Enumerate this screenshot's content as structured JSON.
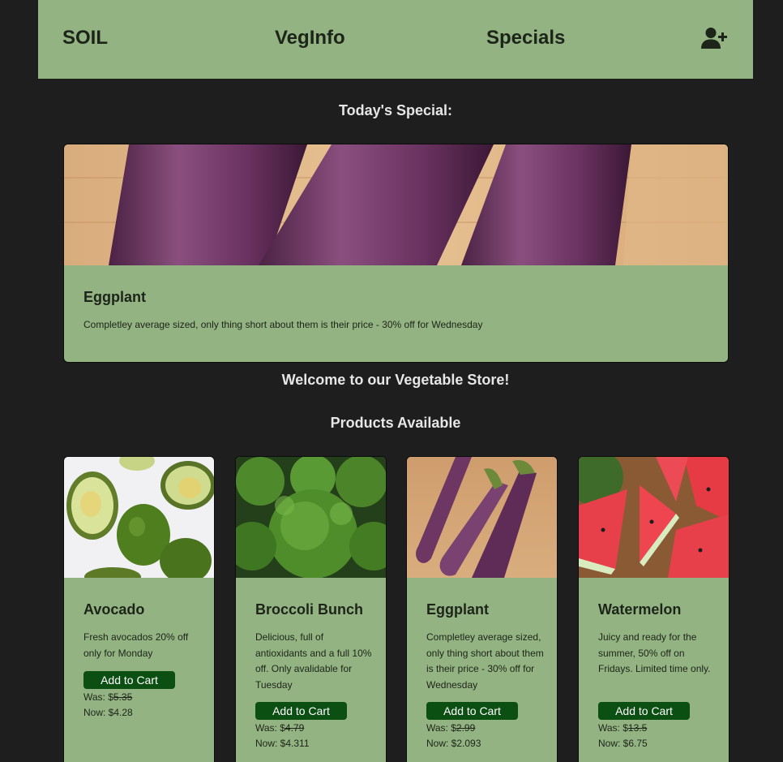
{
  "nav": {
    "brand": "SOIL",
    "veginfo": "VegInfo",
    "specials": "Specials",
    "user_icon": "user-plus-icon"
  },
  "todays_special_heading": "Today's Special:",
  "special": {
    "title": "Eggplant",
    "description": "Completley average sized, only thing short about them is their price - 30% off for Wednesday",
    "image": "eggplant-image"
  },
  "welcome_heading": "Welcome to our Vegetable Store!",
  "products_heading": "Products Available",
  "products": [
    {
      "name": "Avocado",
      "description": "Fresh avocados 20% off only for Monday",
      "button": "Add to Cart",
      "was_label": "Was: $",
      "was_price": "5.35",
      "now_label": "Now: $",
      "now_price": "4.28",
      "image": "avocado-image"
    },
    {
      "name": "Broccoli Bunch",
      "description": "Delicious, full of antioxidants and a full 10% off. Only avalidable for Tuesday",
      "button": "Add to Cart",
      "was_label": "Was: $",
      "was_price": "4.79",
      "now_label": "Now: $",
      "now_price": "4.311",
      "image": "broccoli-image"
    },
    {
      "name": "Eggplant",
      "description": "Completley average sized, only thing short about them is their price - 30% off for Wednesday",
      "button": "Add to Cart",
      "was_label": "Was: $",
      "was_price": "2.99",
      "now_label": "Now: $",
      "now_price": "2.093",
      "image": "eggplant-image"
    },
    {
      "name": "Watermelon",
      "description": "Juicy and ready for the summer, 50% off on Fridays. Limited time only.",
      "button": "Add to Cart",
      "was_label": "Was: $",
      "was_price": "13.5",
      "now_label": "Now: $",
      "now_price": "6.75",
      "image": "watermelon-image"
    }
  ],
  "colors": {
    "background": "#1e1e1f",
    "card_green": "#93b482",
    "button_green": "#0b4f12",
    "heading_text": "#e6e6e6"
  }
}
